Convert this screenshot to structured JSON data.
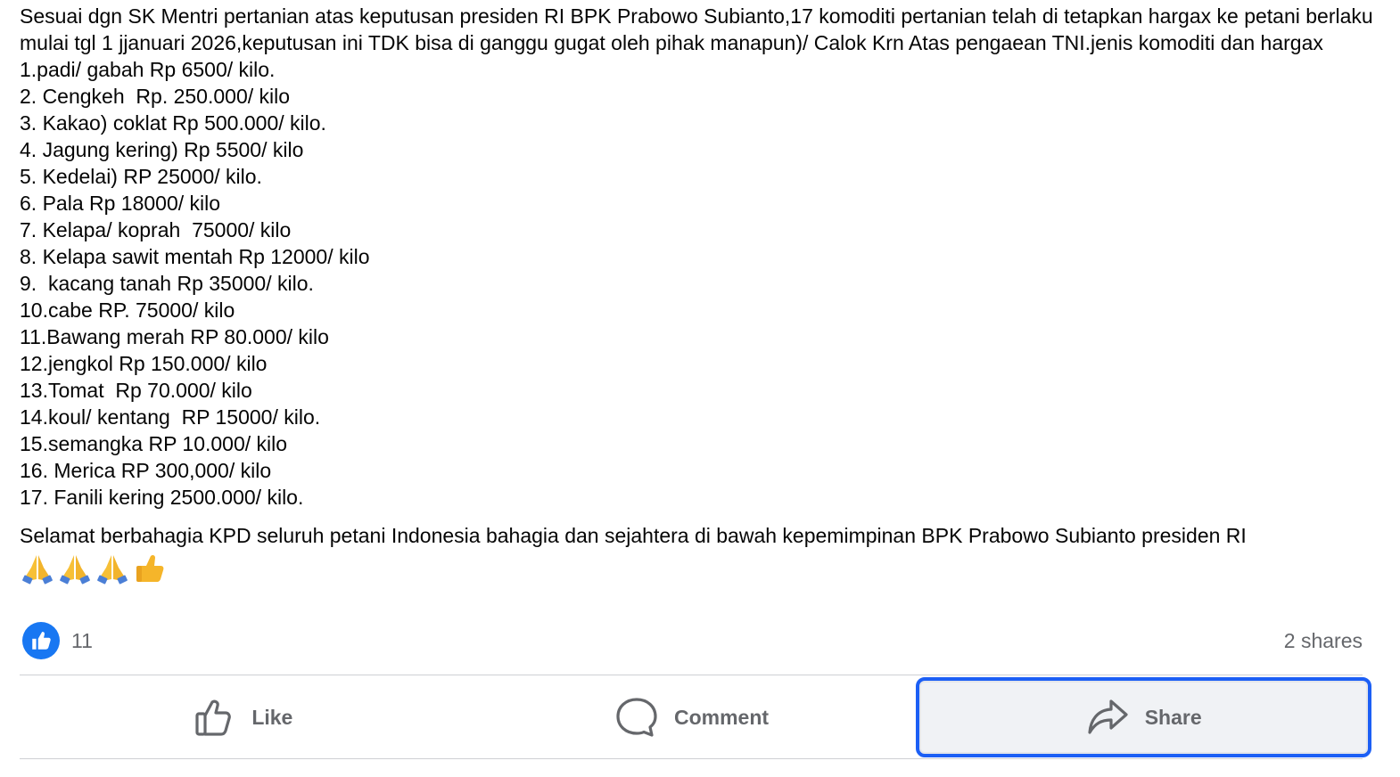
{
  "post": {
    "intro": "Sesuai dgn SK Mentri pertanian atas keputusan presiden RI BPK Prabowo Subianto,17 komoditi pertanian telah di tetapkan hargax ke petani berlaku mulai tgl 1 jjanuari 2026,keputusan ini TDK bisa di ganggu gugat oleh pihak manapun)/ Calok Krn Atas pengaean TNI.jenis komoditi dan hargax",
    "items": [
      "1.padi/ gabah Rp 6500/ kilo.",
      "2. Cengkeh  Rp. 250.000/ kilo",
      "3. Kakao) coklat Rp 500.000/ kilo.",
      "4. Jagung kering) Rp 5500/ kilo",
      "5. Kedelai) RP 25000/ kilo.",
      "6. Pala Rp 18000/ kilo",
      "7. Kelapa/ koprah  75000/ kilo",
      "8. Kelapa sawit mentah Rp 12000/ kilo",
      "9.  kacang tanah Rp 35000/ kilo.",
      "10.cabe RP. 75000/ kilo",
      "11.Bawang merah RP 80.000/ kilo",
      "12.jengkol Rp 150.000/ kilo",
      "13.Tomat  Rp 70.000/ kilo",
      "14.koul/ kentang  RP 15000/ kilo.",
      "15.semangka RP 10.000/ kilo",
      "16. Merica RP 300,000/ kilo",
      "17. Fanili kering 2500.000/ kilo."
    ],
    "closing": "Selamat berbahagia KPD seluruh petani Indonesia bahagia dan sejahtera di bawah kepemimpinan BPK Prabowo Subianto presiden RI",
    "emojis": [
      "folded-hands-icon",
      "folded-hands-icon",
      "folded-hands-icon",
      "thumbs-up-icon"
    ]
  },
  "stats": {
    "reaction_count": "11",
    "shares": "2 shares"
  },
  "actions": {
    "like": "Like",
    "comment": "Comment",
    "share": "Share"
  },
  "colors": {
    "accent": "#1877f2",
    "focus_ring": "#1c5ff5",
    "muted_text": "#65676b",
    "body_text": "#050505"
  }
}
